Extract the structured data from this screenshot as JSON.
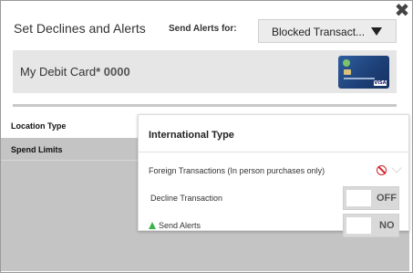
{
  "dialog": {
    "title": "Set Declines and Alerts",
    "close_icon": "close-x-icon"
  },
  "alerts_for": {
    "label": "Send Alerts for:",
    "selected": "Blocked Transact..."
  },
  "card": {
    "name": "My Debit Card",
    "masked_number": "* 0000",
    "image_icon": "debit-card-image"
  },
  "sidebar": {
    "items": [
      {
        "label": "Location Type",
        "active": true
      },
      {
        "label": "Spend Limits",
        "active": false
      }
    ]
  },
  "panel": {
    "title": "International Type",
    "foreign": {
      "label": "Foreign Transactions (In person purchases only)",
      "icon": "blocked-icon"
    },
    "decline": {
      "label": "Decline Transaction",
      "toggle_text": "OFF"
    },
    "alerts": {
      "label": "Send Alerts",
      "icon": "bell-icon",
      "toggle_text": "NO"
    }
  },
  "colors": {
    "block_red": "#d0242b",
    "bell_green": "#3db34a",
    "sidebar_gray": "#c4c4c4",
    "card_blue": "#2f5e9e"
  }
}
